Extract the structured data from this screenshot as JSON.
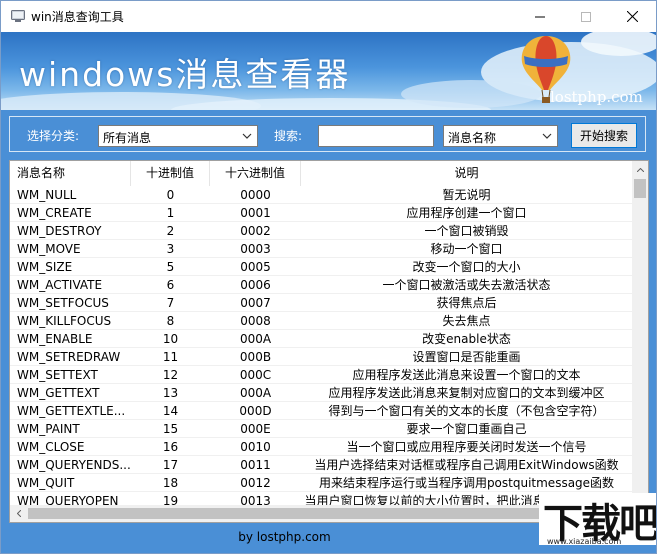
{
  "window": {
    "title": "win消息查询工具",
    "controls": [
      "minimize-icon",
      "maximize-icon",
      "close-icon"
    ]
  },
  "banner": {
    "title": "windows消息查看器",
    "site": "lostphp.com"
  },
  "toolbar": {
    "category_label": "选择分类:",
    "category_value": "所有消息",
    "search_label": "搜索:",
    "search_value": "",
    "field_value": "消息名称",
    "search_button": "开始搜索"
  },
  "table": {
    "columns": [
      "消息名称",
      "十进制值",
      "十六进制值",
      "说明"
    ],
    "rows": [
      [
        "WM_NULL",
        "0",
        "0000",
        "暂无说明"
      ],
      [
        "WM_CREATE",
        "1",
        "0001",
        "应用程序创建一个窗口"
      ],
      [
        "WM_DESTROY",
        "2",
        "0002",
        "一个窗口被销毁"
      ],
      [
        "WM_MOVE",
        "3",
        "0003",
        "移动一个窗口"
      ],
      [
        "WM_SIZE",
        "5",
        "0005",
        "改变一个窗口的大小"
      ],
      [
        "WM_ACTIVATE",
        "6",
        "0006",
        "一个窗口被激活或失去激活状态"
      ],
      [
        "WM_SETFOCUS",
        "7",
        "0007",
        "获得焦点后"
      ],
      [
        "WM_KILLFOCUS",
        "8",
        "0008",
        "失去焦点"
      ],
      [
        "WM_ENABLE",
        "10",
        "000A",
        "改变enable状态"
      ],
      [
        "WM_SETREDRAW",
        "11",
        "000B",
        "设置窗口是否能重画"
      ],
      [
        "WM_SETTEXT",
        "12",
        "000C",
        "应用程序发送此消息来设置一个窗口的文本"
      ],
      [
        "WM_GETTEXT",
        "13",
        "000A",
        "应用程序发送此消息来复制对应窗口的文本到缓冲区"
      ],
      [
        "WM_GETTEXTLE...",
        "14",
        "000D",
        "得到与一个窗口有关的文本的长度（不包含空字符）"
      ],
      [
        "WM_PAINT",
        "15",
        "000E",
        "要求一个窗口重画自己"
      ],
      [
        "WM_CLOSE",
        "16",
        "0010",
        "当一个窗口或应用程序要关闭时发送一个信号"
      ],
      [
        "WM_QUERYENDS...",
        "17",
        "0011",
        "当用户选择结束对话框或程序自己调用ExitWindows函数"
      ],
      [
        "WM_QUIT",
        "18",
        "0012",
        "用来结束程序运行或当程序调用postquitmessage函数"
      ],
      [
        "WM_QUERYOPEN",
        "19",
        "0013",
        "当用户窗口恢复以前的大小位置时，把此消息发送给某个图标"
      ]
    ]
  },
  "footer": {
    "text": "by lostphp.com"
  },
  "watermark": {
    "brand": "下载吧",
    "site": "www.xiazaiba.com"
  }
}
